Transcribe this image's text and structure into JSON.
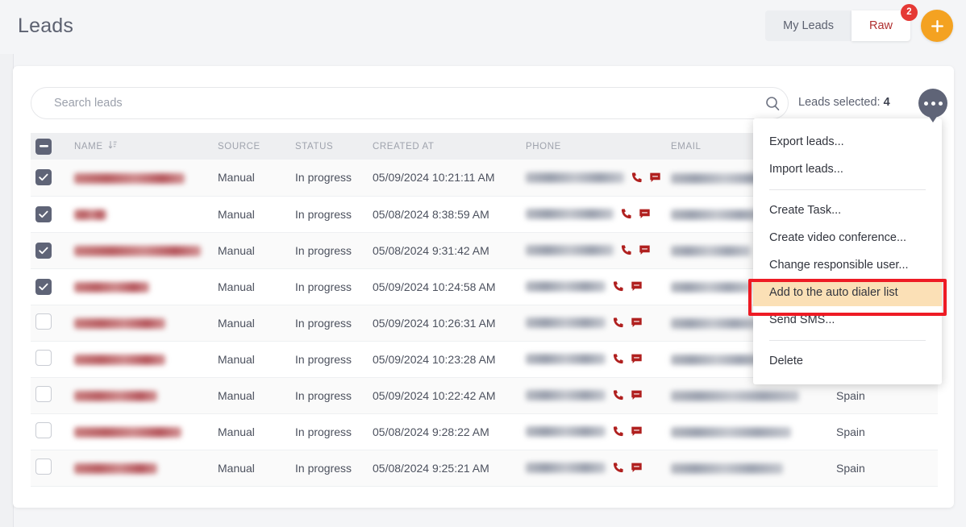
{
  "header": {
    "title": "Leads",
    "tabs": [
      {
        "label": "My Leads",
        "active": false,
        "badge": null
      },
      {
        "label": "Raw",
        "active": true,
        "badge": "2"
      }
    ],
    "add_button_icon": "plus-icon",
    "accent_orange": "#f4a221",
    "badge_red": "#e53935"
  },
  "search": {
    "placeholder": "Search leads",
    "value": "",
    "icon": "search-icon"
  },
  "selection": {
    "label": "Leads selected:",
    "count": "4",
    "more_button_icon": "ellipsis-icon"
  },
  "table": {
    "columns": [
      {
        "key": "checkbox",
        "label": ""
      },
      {
        "key": "name",
        "label": "NAME",
        "sort_icon": "sort-icon"
      },
      {
        "key": "source",
        "label": "SOURCE"
      },
      {
        "key": "status",
        "label": "STATUS"
      },
      {
        "key": "created_at",
        "label": "CREATED AT"
      },
      {
        "key": "phone",
        "label": "PHONE"
      },
      {
        "key": "email",
        "label": "EMAIL"
      },
      {
        "key": "country",
        "label": ""
      }
    ],
    "header_checkbox_state": "indeterminate",
    "rows": [
      {
        "checked": true,
        "name": "██████ █████ ██",
        "source": "Manual",
        "status": "In progress",
        "created_at": "05/09/2024 10:21:11 AM",
        "phone": "█████ ███████",
        "email": "██████████████",
        "country": ""
      },
      {
        "checked": true,
        "name": "████",
        "source": "Manual",
        "status": "In progress",
        "created_at": "05/08/2024 8:38:59 AM",
        "phone": "███████████",
        "email": "████████████",
        "country": ""
      },
      {
        "checked": true,
        "name": "███ █████ ███████",
        "source": "Manual",
        "status": "In progress",
        "created_at": "05/08/2024 9:31:42 AM",
        "phone": "███████████",
        "email": "██████████",
        "country": ""
      },
      {
        "checked": true,
        "name": "████ █████",
        "source": "Manual",
        "status": "In progress",
        "created_at": "05/09/2024 10:24:58 AM",
        "phone": "██████████",
        "email": "██████████",
        "country": ""
      },
      {
        "checked": false,
        "name": "█████ ██████",
        "source": "Manual",
        "status": "In progress",
        "created_at": "05/09/2024 10:26:31 AM",
        "phone": "██████████",
        "email": "███████████",
        "country": ""
      },
      {
        "checked": false,
        "name": "██████ █████",
        "source": "Manual",
        "status": "In progress",
        "created_at": "05/09/2024 10:23:28 AM",
        "phone": "██████████",
        "email": "████████████",
        "country": ""
      },
      {
        "checked": false,
        "name": "██████ ████",
        "source": "Manual",
        "status": "In progress",
        "created_at": "05/09/2024 10:22:42 AM",
        "phone": "██████████",
        "email": "████████████████",
        "country": "Spain"
      },
      {
        "checked": false,
        "name": "███████ ██████",
        "source": "Manual",
        "status": "In progress",
        "created_at": "05/08/2024 9:28:22 AM",
        "phone": "██████████",
        "email": "███████████████",
        "country": "Spain"
      },
      {
        "checked": false,
        "name": "█████ █████",
        "source": "Manual",
        "status": "In progress",
        "created_at": "05/08/2024 9:25:21 AM",
        "phone": "██████████",
        "email": "██████████████",
        "country": "Spain"
      }
    ],
    "row_icons": {
      "call": "phone-icon",
      "sms": "chat-bubble-icon"
    }
  },
  "context_menu": {
    "items": [
      {
        "label": "Export leads...",
        "highlighted": false,
        "separator_after": false
      },
      {
        "label": "Import leads...",
        "highlighted": false,
        "separator_after": true
      },
      {
        "label": "Create Task...",
        "highlighted": false,
        "separator_after": false
      },
      {
        "label": "Create video conference...",
        "highlighted": false,
        "separator_after": false
      },
      {
        "label": "Change responsible user...",
        "highlighted": false,
        "separator_after": false
      },
      {
        "label": "Add to the auto dialer list",
        "highlighted": true,
        "separator_after": false
      },
      {
        "label": "Send SMS...",
        "highlighted": false,
        "separator_after": true
      },
      {
        "label": "Delete",
        "highlighted": false,
        "separator_after": false
      }
    ],
    "highlight_color": "#fbe0b6",
    "annotation_color": "#ee1b24"
  }
}
